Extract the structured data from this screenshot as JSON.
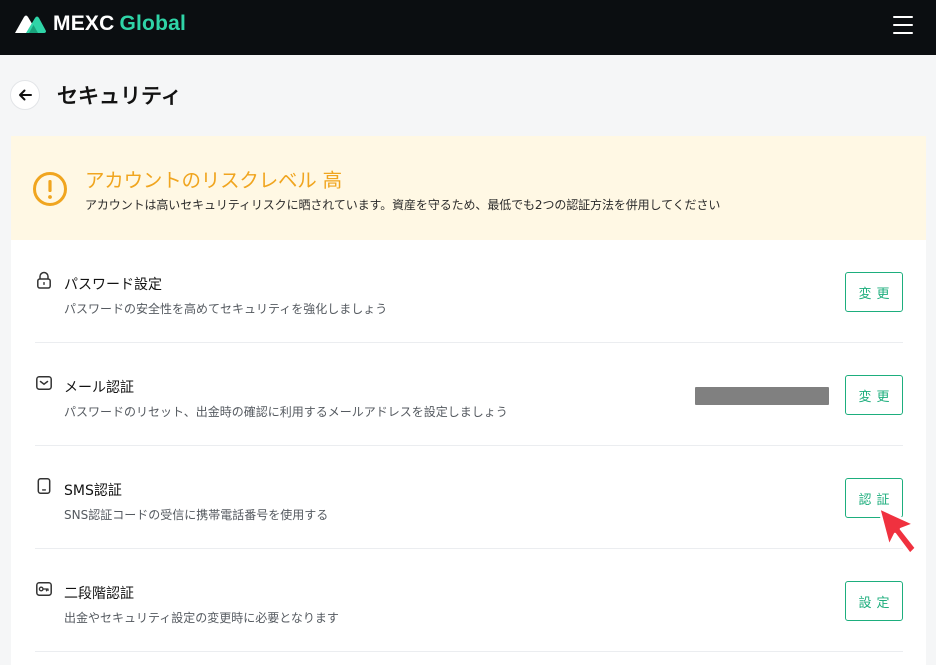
{
  "header": {
    "logo_main": "MEXC",
    "logo_accent": "Global",
    "logo_icon": "mountain-logo-icon",
    "menu_icon": "hamburger-menu-icon"
  },
  "page": {
    "title": "セキュリティ",
    "back_icon": "arrow-left-icon"
  },
  "risk_banner": {
    "icon": "warning-circle-icon",
    "title": "アカウントのリスクレベル 高",
    "description": "アカウントは高いセキュリティリスクに晒されています。資産を守るため、最低でも2つの認証方法を併用してください",
    "color": "#f0a51f",
    "background": "#fff8e4"
  },
  "security_items": [
    {
      "icon": "lock-icon",
      "title": "パスワード設定",
      "description": "パスワードの安全性を高めてセキュリティを強化しましょう",
      "button_label": "変更"
    },
    {
      "icon": "mail-icon",
      "title": "メール認証",
      "description": "パスワードのリセット、出金時の確認に利用するメールアドレスを設定しましょう",
      "button_label": "変更"
    },
    {
      "icon": "phone-icon",
      "title": "SMS認証",
      "description": "SNS認証コードの受信に携帯電話番号を使用する",
      "button_label": "認証"
    },
    {
      "icon": "key-icon",
      "title": "二段階認証",
      "description": "出金やセキュリティ設定の変更時に必要となります",
      "button_label": "設定"
    }
  ],
  "colors": {
    "accent": "#1dae7d",
    "topbar": "#0b0e11",
    "brand_accent": "#2fd4a7",
    "pointer": "#f0313f"
  },
  "pointer_icon": "red-arrow-pointer-icon"
}
